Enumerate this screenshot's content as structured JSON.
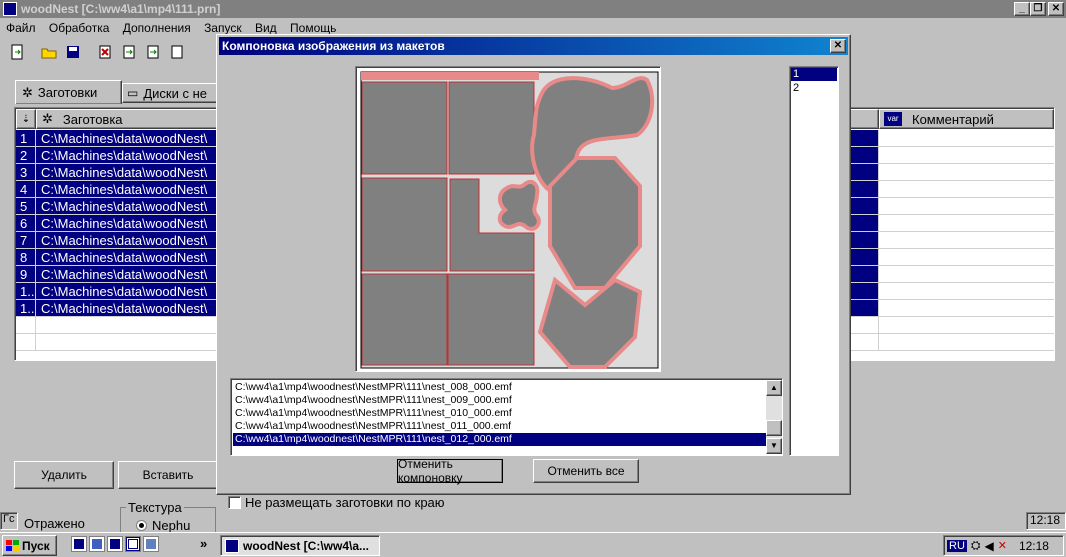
{
  "main_window": {
    "title": "woodNest [C:\\ww4\\a1\\mp4\\111.prn]",
    "menu": [
      "Файл",
      "Обработка",
      "Дополнения",
      "Запуск",
      "Вид",
      "Помощь"
    ],
    "tabs": [
      "Заготовки",
      "Диски с не"
    ],
    "grid_headers": {
      "num": "",
      "blank": "Заготовка",
      "comment": "Комментарий"
    },
    "rows": [
      {
        "num": "1",
        "path": "C:\\Machines\\data\\woodNest\\"
      },
      {
        "num": "2",
        "path": "C:\\Machines\\data\\woodNest\\"
      },
      {
        "num": "3",
        "path": "C:\\Machines\\data\\woodNest\\"
      },
      {
        "num": "4",
        "path": "C:\\Machines\\data\\woodNest\\"
      },
      {
        "num": "5",
        "path": "C:\\Machines\\data\\woodNest\\"
      },
      {
        "num": "6",
        "path": "C:\\Machines\\data\\woodNest\\"
      },
      {
        "num": "7",
        "path": "C:\\Machines\\data\\woodNest\\"
      },
      {
        "num": "8",
        "path": "C:\\Machines\\data\\woodNest\\"
      },
      {
        "num": "9",
        "path": "C:\\Machines\\data\\woodNest\\"
      },
      {
        "num": "1...",
        "path": "C:\\Machines\\data\\woodNest\\"
      },
      {
        "num": "1...",
        "path": "C:\\Machines\\data\\woodNest\\"
      }
    ],
    "buttons": {
      "delete": "Удалить",
      "insert": "Вставить"
    },
    "no_edge_checkbox": "Не размещать заготовки по краю",
    "texture_group": "Текстура",
    "texture_option": "Nephu",
    "reflected_label": "Отражено",
    "left_label": "Гс",
    "status_time": "12:18"
  },
  "dialog": {
    "title": "Компоновка изображения из макетов",
    "layouts": [
      "1",
      "2"
    ],
    "selected_layout": "1",
    "files": [
      "C:\\ww4\\a1\\mp4\\woodnest\\NestMPR\\111\\nest_008_000.emf",
      "C:\\ww4\\a1\\mp4\\woodnest\\NestMPR\\111\\nest_009_000.emf",
      "C:\\ww4\\a1\\mp4\\woodnest\\NestMPR\\111\\nest_010_000.emf",
      "C:\\ww4\\a1\\mp4\\woodnest\\NestMPR\\111\\nest_011_000.emf",
      "C:\\ww4\\a1\\mp4\\woodnest\\NestMPR\\111\\nest_012_000.emf"
    ],
    "selected_file_index": 4,
    "cancel_layout": "Отменить компоновку",
    "cancel_all": "Отменить все"
  },
  "taskbar": {
    "start": "Пуск",
    "task": "woodNest [C:\\ww4\\a...",
    "lang": "RU",
    "clock": "12:18",
    "more": "»"
  },
  "colors": {
    "selection": "#000080",
    "piece": "#808080",
    "piece_outline": "#e88a8a"
  }
}
